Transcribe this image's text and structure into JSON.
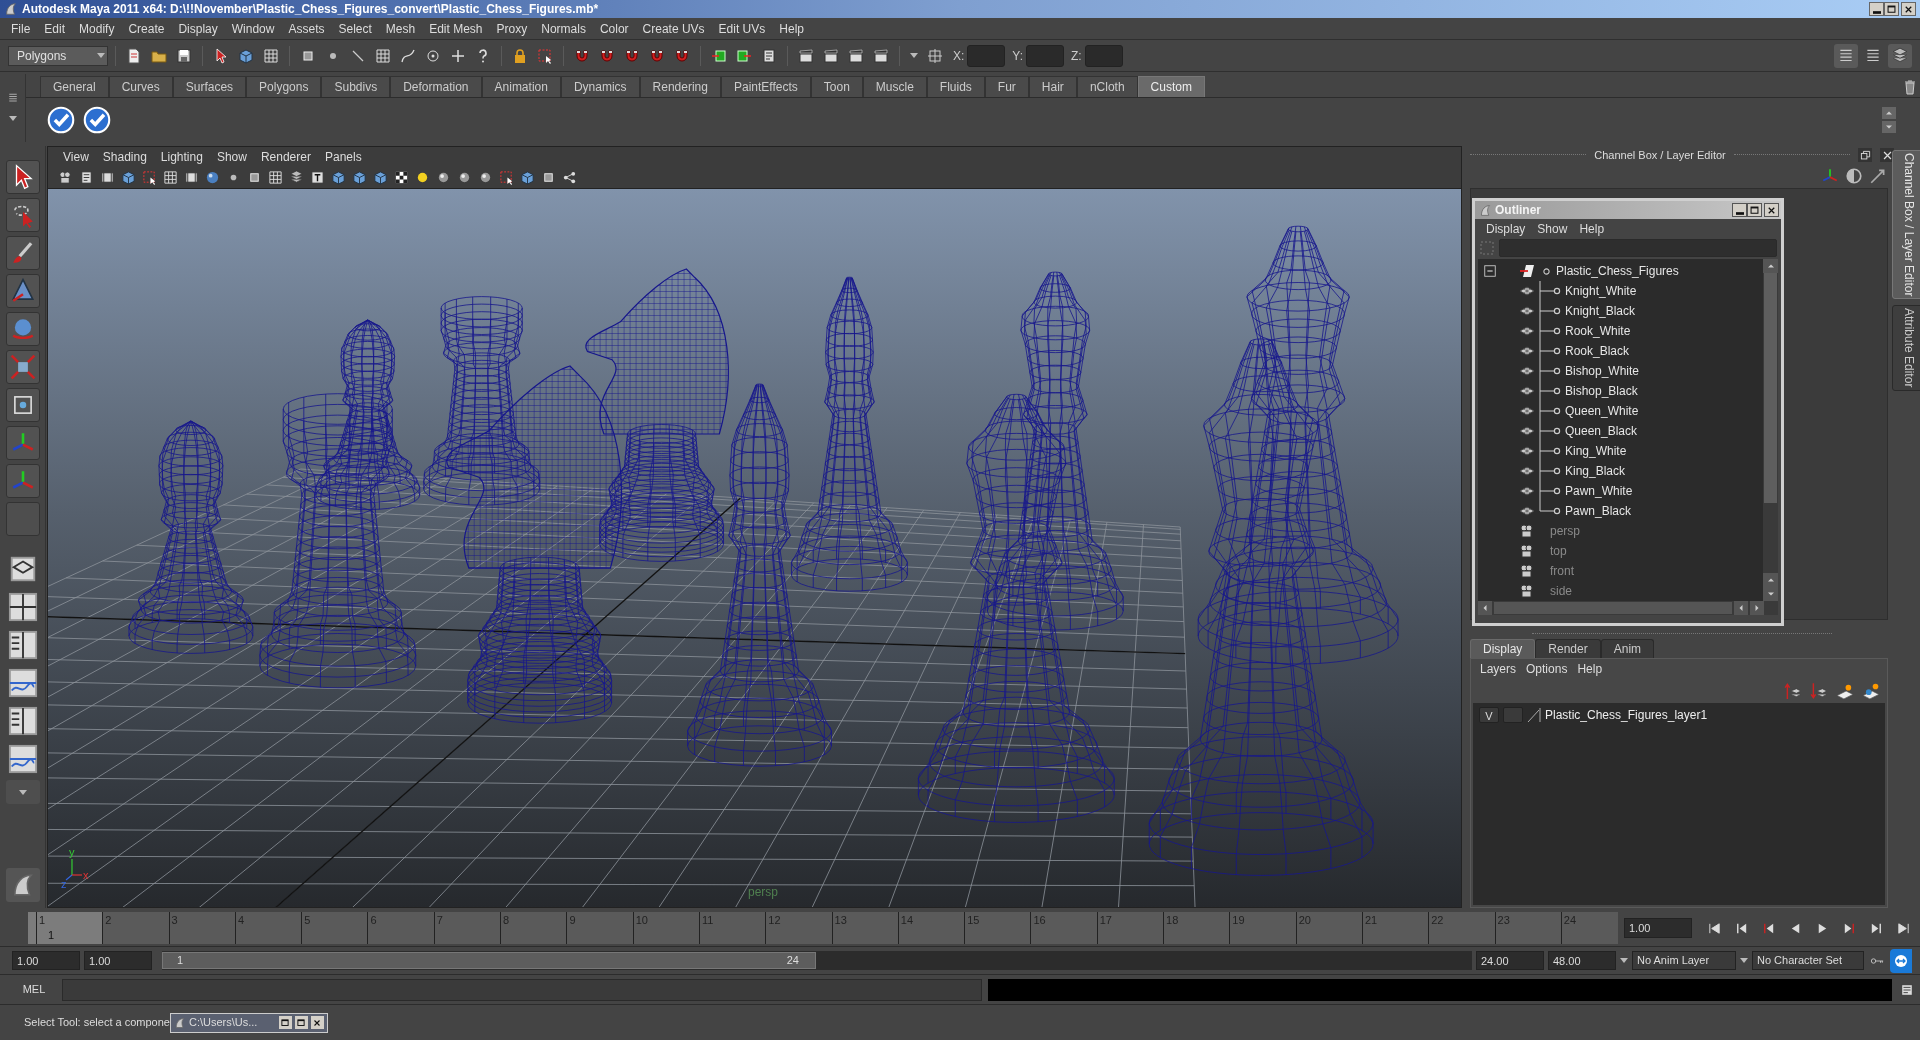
{
  "window": {
    "title": "Autodesk Maya 2011 x64: D:\\!!November\\Plastic_Chess_Figures_convert\\Plastic_Chess_Figures.mb*"
  },
  "menu_bar": [
    "File",
    "Edit",
    "Modify",
    "Create",
    "Display",
    "Window",
    "Assets",
    "Select",
    "Mesh",
    "Edit Mesh",
    "Proxy",
    "Normals",
    "Color",
    "Create UVs",
    "Edit UVs",
    "Help"
  ],
  "status_line": {
    "menu_set": "Polygons",
    "coord_labels": [
      "X:",
      "Y:",
      "Z:"
    ]
  },
  "shelf": {
    "tabs": [
      {
        "label": "General",
        "selected": false
      },
      {
        "label": "Curves",
        "selected": false
      },
      {
        "label": "Surfaces",
        "selected": false
      },
      {
        "label": "Polygons",
        "selected": false
      },
      {
        "label": "Subdivs",
        "selected": false
      },
      {
        "label": "Deformation",
        "selected": false
      },
      {
        "label": "Animation",
        "selected": false
      },
      {
        "label": "Dynamics",
        "selected": false
      },
      {
        "label": "Rendering",
        "selected": false
      },
      {
        "label": "PaintEffects",
        "selected": false
      },
      {
        "label": "Toon",
        "selected": false
      },
      {
        "label": "Muscle",
        "selected": false
      },
      {
        "label": "Fluids",
        "selected": false
      },
      {
        "label": "Fur",
        "selected": false
      },
      {
        "label": "Hair",
        "selected": false
      },
      {
        "label": "nCloth",
        "selected": false
      },
      {
        "label": "Custom",
        "selected": true
      }
    ]
  },
  "viewport": {
    "menu": [
      "View",
      "Shading",
      "Lighting",
      "Show",
      "Renderer",
      "Panels"
    ],
    "camera_label": "persp",
    "axis_labels": [
      "y",
      "x",
      "z"
    ]
  },
  "channel_box": {
    "title": "Channel Box / Layer Editor"
  },
  "side_tabs": [
    {
      "label": "Channel Box / Layer Editor",
      "selected": true
    },
    {
      "label": "Attribute Editor",
      "selected": false
    }
  ],
  "outliner": {
    "title": "Outliner",
    "menu": [
      "Display",
      "Show",
      "Help"
    ],
    "items": [
      {
        "label": "Plastic_Chess_Figures",
        "kind": "group",
        "expanded": true,
        "children": [
          {
            "label": "Knight_White",
            "kind": "mesh"
          },
          {
            "label": "Knight_Black",
            "kind": "mesh"
          },
          {
            "label": "Rook_White",
            "kind": "mesh"
          },
          {
            "label": "Rook_Black",
            "kind": "mesh"
          },
          {
            "label": "Bishop_White",
            "kind": "mesh"
          },
          {
            "label": "Bishop_Black",
            "kind": "mesh"
          },
          {
            "label": "Queen_White",
            "kind": "mesh"
          },
          {
            "label": "Queen_Black",
            "kind": "mesh"
          },
          {
            "label": "King_White",
            "kind": "mesh"
          },
          {
            "label": "King_Black",
            "kind": "mesh"
          },
          {
            "label": "Pawn_White",
            "kind": "mesh"
          },
          {
            "label": "Pawn_Black",
            "kind": "mesh"
          }
        ]
      },
      {
        "label": "persp",
        "kind": "camera"
      },
      {
        "label": "top",
        "kind": "camera"
      },
      {
        "label": "front",
        "kind": "camera"
      },
      {
        "label": "side",
        "kind": "camera"
      }
    ]
  },
  "layer_editor": {
    "tabs": [
      {
        "label": "Display",
        "selected": true
      },
      {
        "label": "Render",
        "selected": false
      },
      {
        "label": "Anim",
        "selected": false
      }
    ],
    "menu": [
      "Layers",
      "Options",
      "Help"
    ],
    "layers": [
      {
        "visibility": "V",
        "name": "Plastic_Chess_Figures_layer1"
      }
    ]
  },
  "time_slider": {
    "ticks": [
      "1",
      "2",
      "3",
      "4",
      "5",
      "6",
      "7",
      "8",
      "9",
      "10",
      "11",
      "12",
      "13",
      "14",
      "15",
      "16",
      "17",
      "18",
      "19",
      "20",
      "21",
      "22",
      "23",
      "24"
    ],
    "current_frame": "1",
    "level": 0,
    "current_time": "1.00"
  },
  "range_slider": {
    "start_time": "1.00",
    "playback_start": "1.00",
    "range_start": "1",
    "range_end": "24",
    "playback_end": "24.00",
    "end_time": "48.00",
    "anim_layer": "No Anim Layer",
    "character_set": "No Character Set"
  },
  "command_line": {
    "label": "MEL"
  },
  "help_line": {
    "text": "Select Tool: select a compone"
  },
  "minimized_window": {
    "title": "C:\\Users\\Us..."
  }
}
